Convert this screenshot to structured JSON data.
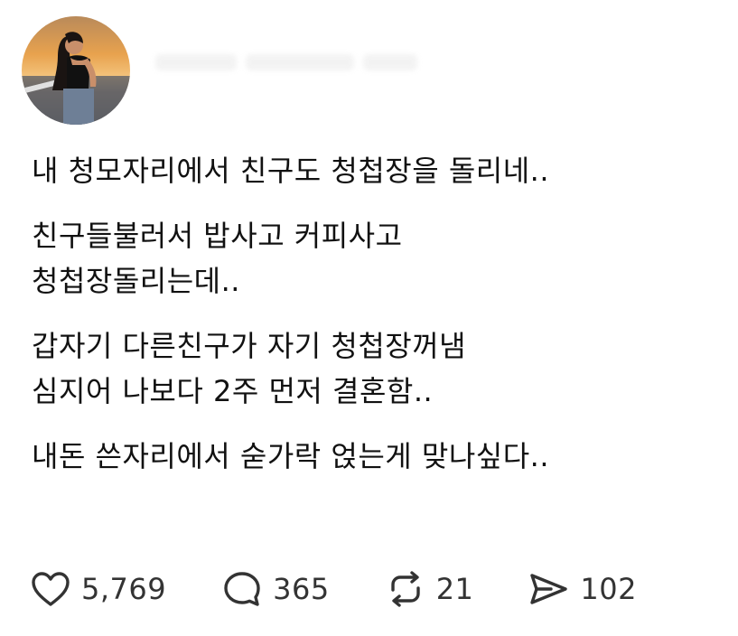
{
  "post": {
    "paragraphs": [
      [
        "내 청모자리에서 친구도 청첩장을 돌리네.."
      ],
      [
        "친구들불러서 밥사고 커피사고",
        "청첩장돌리는데.."
      ],
      [
        "갑자기 다른친구가 자기 청첩장꺼냄",
        "심지어 나보다 2주 먼저 결혼함.."
      ],
      [
        "내돈 쓴자리에서 숟가락 얹는게 맞나싶다.."
      ]
    ]
  },
  "actions": {
    "like": {
      "icon": "heart-icon",
      "count": "5,769"
    },
    "comment": {
      "icon": "speech-bubble-icon",
      "count": "365"
    },
    "repost": {
      "icon": "repost-icon",
      "count": "21"
    },
    "share": {
      "icon": "send-icon",
      "count": "102"
    }
  },
  "colors": {
    "text": "#111111",
    "icon": "#333333",
    "background": "#ffffff"
  }
}
